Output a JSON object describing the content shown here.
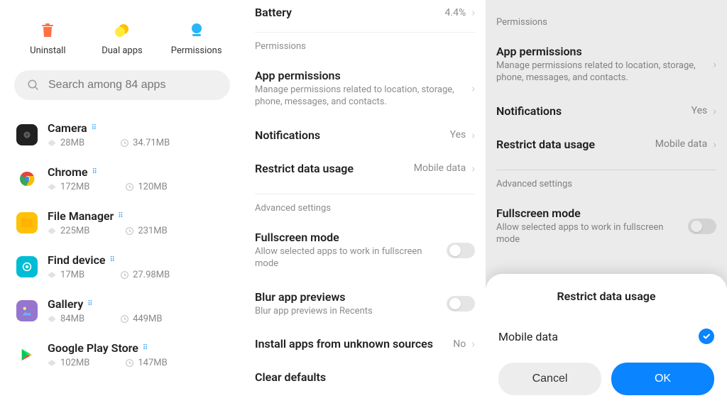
{
  "pane1": {
    "actions": [
      {
        "label": "Uninstall"
      },
      {
        "label": "Dual apps"
      },
      {
        "label": "Permissions"
      }
    ],
    "search_placeholder": "Search among 84 apps",
    "apps": [
      {
        "name": "Camera",
        "size1": "28MB",
        "size2": "34.71MB",
        "icon_bg": "#212121",
        "icon_fg": "#757575"
      },
      {
        "name": "Chrome",
        "size1": "172MB",
        "size2": "120MB",
        "icon_bg": "#ffffff",
        "icon_fg": "#4285f4"
      },
      {
        "name": "File Manager",
        "size1": "225MB",
        "size2": "231MB",
        "icon_bg": "#ffc107",
        "icon_fg": "#fff"
      },
      {
        "name": "Find device",
        "size1": "17MB",
        "size2": "27.98MB",
        "icon_bg": "#00bcd4",
        "icon_fg": "#fff"
      },
      {
        "name": "Gallery",
        "size1": "84MB",
        "size2": "449MB",
        "icon_bg": "#9575cd",
        "icon_fg": "#fff"
      },
      {
        "name": "Google Play Store",
        "size1": "102MB",
        "size2": "147MB",
        "icon_bg": "#ffffff",
        "icon_fg": "#4caf50"
      }
    ]
  },
  "pane2": {
    "battery": {
      "title": "Battery",
      "value": "4.4%"
    },
    "permissions_header": "Permissions",
    "app_permissions": {
      "title": "App permissions",
      "desc": "Manage permissions related to location, storage, phone, messages, and contacts."
    },
    "notifications": {
      "title": "Notifications",
      "value": "Yes"
    },
    "restrict_data": {
      "title": "Restrict data usage",
      "value": "Mobile data"
    },
    "advanced_header": "Advanced settings",
    "fullscreen": {
      "title": "Fullscreen mode",
      "desc": "Allow selected apps to work in fullscreen mode"
    },
    "blur": {
      "title": "Blur app previews",
      "desc": "Blur app previews in Recents"
    },
    "install_unknown": {
      "title": "Install apps from unknown sources",
      "value": "No"
    },
    "clear_defaults": {
      "title": "Clear defaults"
    }
  },
  "pane3": {
    "dialog_title": "Restrict data usage",
    "option_label": "Mobile data",
    "cancel": "Cancel",
    "ok": "OK"
  }
}
